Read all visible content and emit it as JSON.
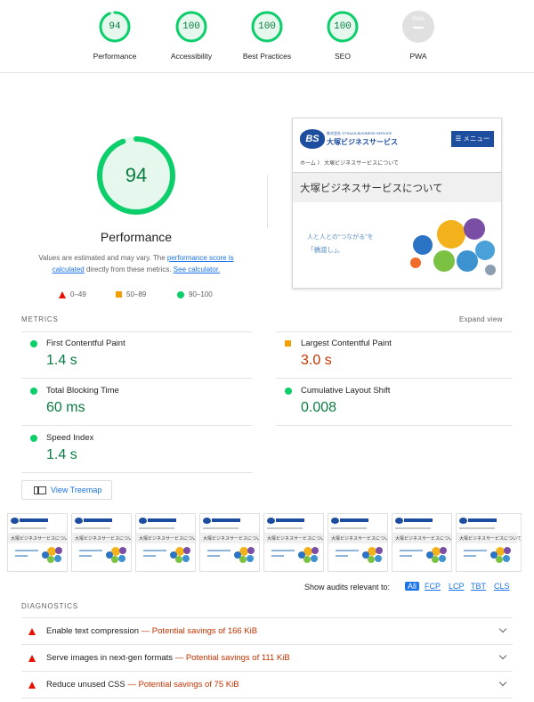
{
  "summary": {
    "categories": [
      {
        "label": "Performance",
        "score": "94"
      },
      {
        "label": "Accessibility",
        "score": "100"
      },
      {
        "label": "Best Practices",
        "score": "100"
      },
      {
        "label": "SEO",
        "score": "100"
      },
      {
        "label": "PWA",
        "badge": "PWA"
      }
    ]
  },
  "performance": {
    "score": "94",
    "score_fraction": 0.94,
    "title": "Performance",
    "desc_prefix": "Values are estimated and may vary. The ",
    "desc_link": "performance score is calculated",
    "desc_mid": " directly from these metrics. ",
    "desc_calc": "See calculator.",
    "legend": [
      {
        "range": "0–49",
        "shape": "triangle",
        "color": "#eb0f00"
      },
      {
        "range": "50–89",
        "shape": "square",
        "color": "#f29f06"
      },
      {
        "range": "90–100",
        "shape": "circle",
        "color": "#0cce6b"
      }
    ]
  },
  "preview": {
    "logo_mark": "BS",
    "logo_sub": "株式会社 OTSUKA BUSINESS SERVICE",
    "logo_name": "大塚ビジネスサービス",
    "menu_label": "☰ メニュー",
    "breadcrumb": "ホーム 〉 大塚ビジネスサービスについて",
    "headline": "大塚ビジネスサービスについて",
    "tagline1": "人と人との“つながる”を",
    "tagline2": "「橋渡し」。"
  },
  "metrics": {
    "section_label": "METRICS",
    "expand_label": "Expand view",
    "items": [
      {
        "title": "First Contentful Paint",
        "value": "1.4 s",
        "status": "pass"
      },
      {
        "title": "Largest Contentful Paint",
        "value": "3.0 s",
        "status": "average"
      },
      {
        "title": "Total Blocking Time",
        "value": "60 ms",
        "status": "pass"
      },
      {
        "title": "Cumulative Layout Shift",
        "value": "0.008",
        "status": "pass"
      },
      {
        "title": "Speed Index",
        "value": "1.4 s",
        "status": "pass"
      }
    ]
  },
  "treemap": {
    "label": "View Treemap"
  },
  "filmstrip": {
    "frame_headline": "大塚ビジネスサービスについて"
  },
  "audit_filter": {
    "label": "Show audits relevant to:",
    "options": [
      "All",
      "FCP",
      "LCP",
      "TBT",
      "CLS"
    ],
    "active": "All"
  },
  "diagnostics": {
    "section_label": "DIAGNOSTICS",
    "items": [
      {
        "title": "Enable text compression",
        "savings": "— Potential savings of 166 KiB"
      },
      {
        "title": "Serve images in next-gen formats",
        "savings": "— Potential savings of 111 KiB"
      },
      {
        "title": "Reduce unused CSS",
        "savings": "— Potential savings of 75 KiB"
      }
    ]
  },
  "colors": {
    "pass": "#0cce6b",
    "pass_text": "#0a7c42",
    "fail": "#eb0f00",
    "average": "#f29f06",
    "average_text": "#c33300",
    "link": "#1a73e8"
  }
}
